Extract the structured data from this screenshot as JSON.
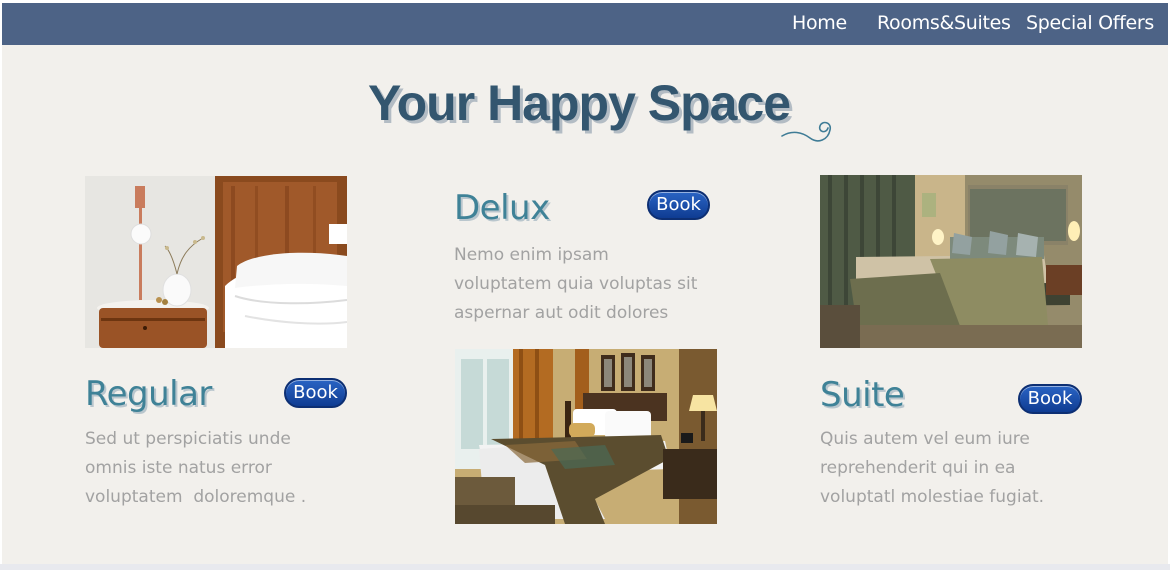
{
  "nav": {
    "items": [
      {
        "label": "Home"
      },
      {
        "label": "Rooms&Suites"
      },
      {
        "label": "Special Offers"
      }
    ]
  },
  "hero": {
    "title": "Your Happy Space",
    "swirl_icon": "swirl-icon"
  },
  "rooms": {
    "regular": {
      "name": "Regular",
      "book_label": "Book",
      "description": "Sed ut perspiciatis unde\nomnis iste natus error\nvoluptatem  doloremque ."
    },
    "delux": {
      "name": "Delux",
      "book_label": "Book",
      "description": "Nemo enim ipsam\nvoluptatem quia voluptas sit\naspernar aut odit dolores"
    },
    "suite": {
      "name": "Suite",
      "book_label": "Book",
      "description": "Quis autem vel eum iure\nreprehenderit qui in ea\nvoluptatl molestiae fugiat."
    }
  },
  "colors": {
    "nav_bg": "#4d6386",
    "page_bg": "#f2f0ec",
    "title": "#33566f",
    "card_title": "#3f8297",
    "book_button": "#1a4fae",
    "description": "#a2a2a2"
  }
}
